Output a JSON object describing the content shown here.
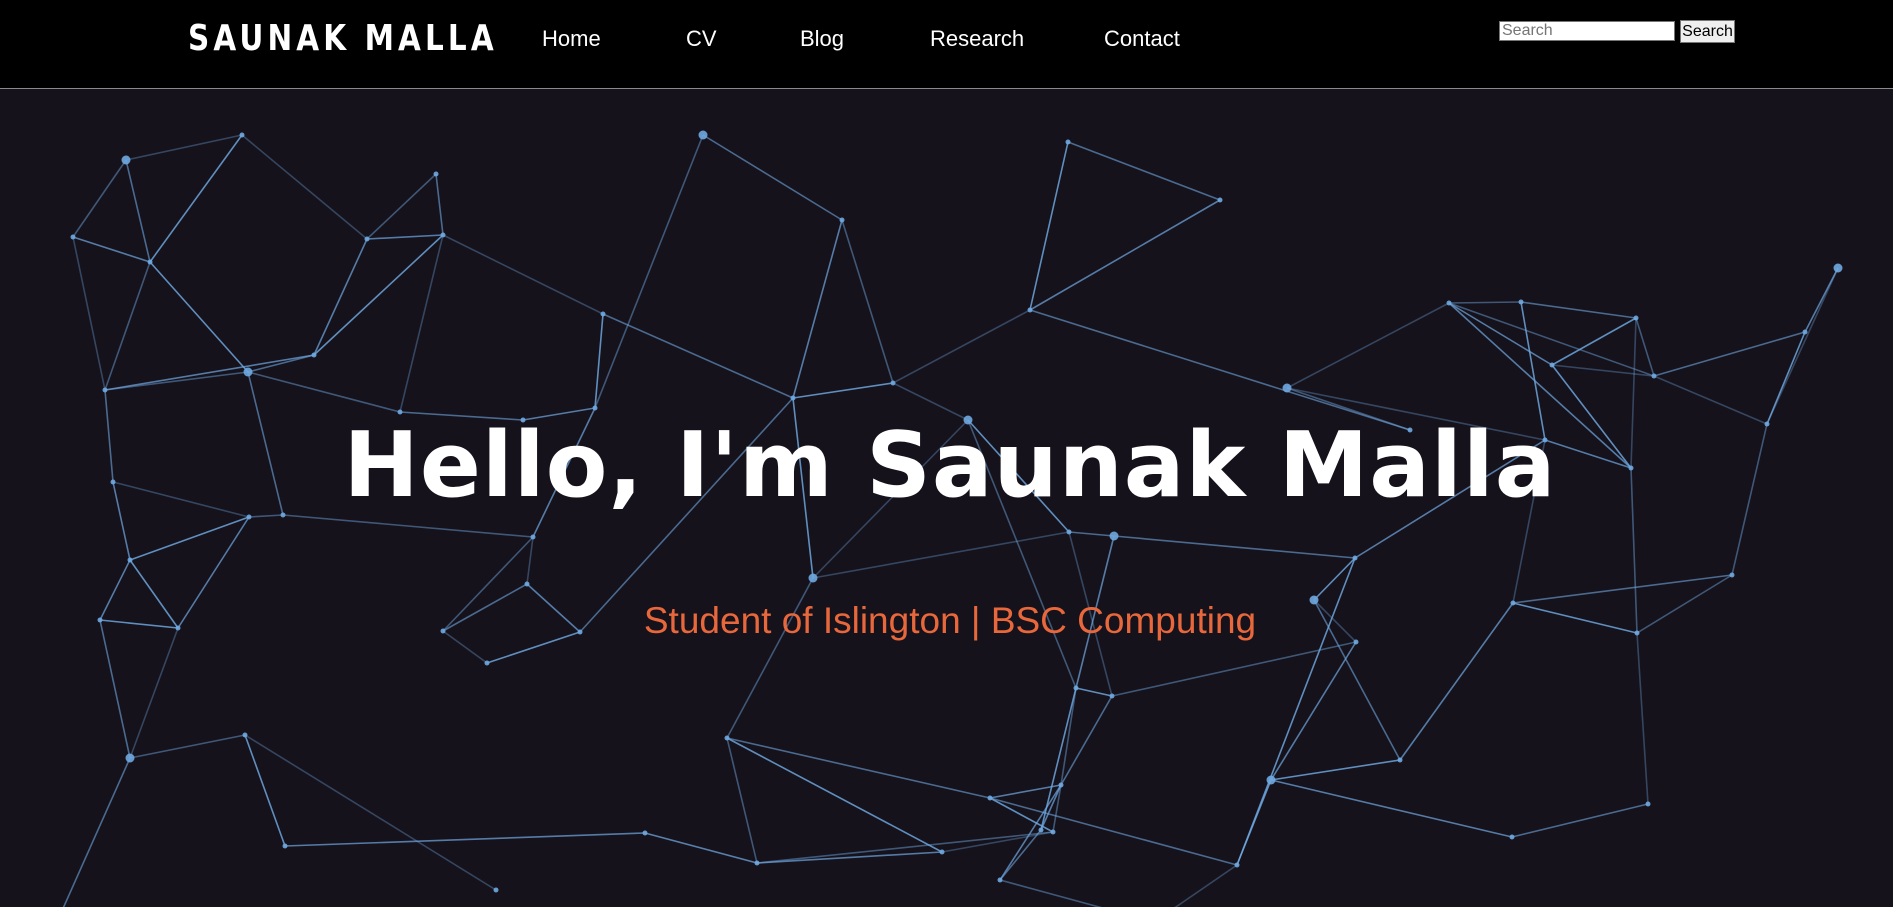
{
  "header": {
    "brand": "SAUNAK MALLA",
    "nav": [
      {
        "label": "Home"
      },
      {
        "label": "CV"
      },
      {
        "label": "Blog"
      },
      {
        "label": "Research"
      },
      {
        "label": "Contact"
      }
    ],
    "search": {
      "placeholder": "Search",
      "value": "",
      "button_label": "Search"
    }
  },
  "hero": {
    "title": "Hello, I'm Saunak Malla",
    "subtitle": "Student of Islington | BSC Computing",
    "background": "particle-network-background"
  },
  "colors": {
    "nav_background": "#000000",
    "page_background": "#16121c",
    "title": "#ffffff",
    "subtitle": "#e8683c",
    "network_line": "#6fa8e0"
  }
}
